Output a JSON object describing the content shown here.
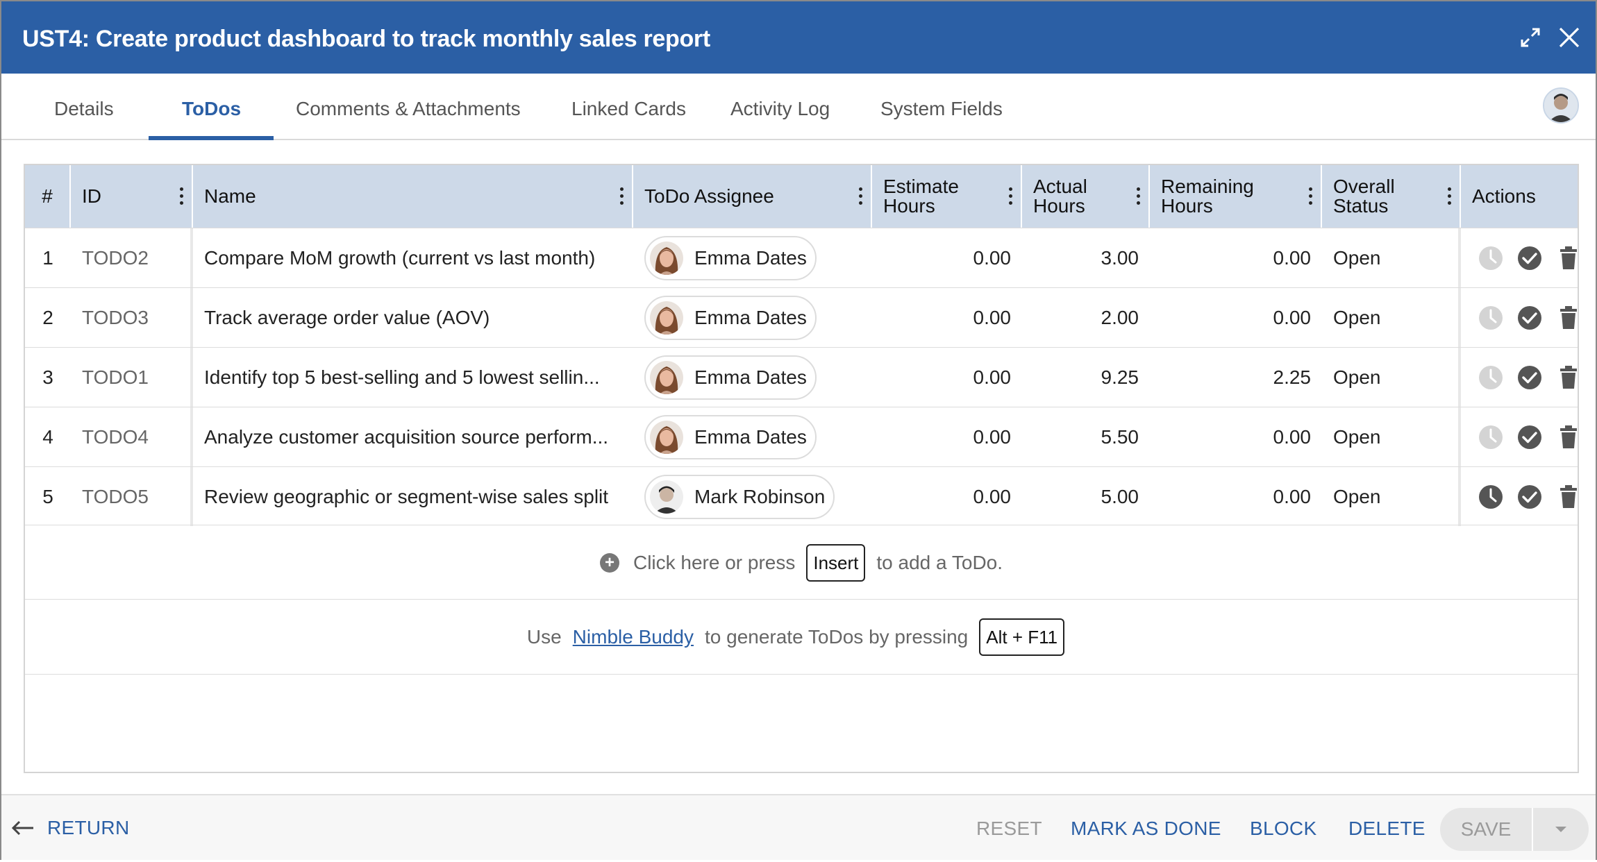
{
  "header": {
    "title": "UST4: Create product dashboard to track monthly sales report",
    "color": "#2b5fa5"
  },
  "tabs": [
    {
      "label": "Details"
    },
    {
      "label": "ToDos",
      "active": true
    },
    {
      "label": "Comments & Attachments"
    },
    {
      "label": "Linked Cards"
    },
    {
      "label": "Activity Log"
    },
    {
      "label": "System Fields"
    }
  ],
  "table": {
    "columns": {
      "num": "#",
      "id": "ID",
      "name": "Name",
      "assignee": "ToDo Assignee",
      "estimate": "Estimate Hours",
      "actual": "Actual Hours",
      "remaining": "Remaining Hours",
      "status": "Overall Status",
      "actions": "Actions"
    },
    "rows": [
      {
        "num": "1",
        "id": "TODO2",
        "name": "Compare MoM growth (current vs last month)",
        "assignee": "Emma Dates",
        "estimate": "0.00",
        "actual": "3.00",
        "remaining": "0.00",
        "status": "Open"
      },
      {
        "num": "2",
        "id": "TODO3",
        "name": "Track average order value (AOV)",
        "assignee": "Emma Dates",
        "estimate": "0.00",
        "actual": "2.00",
        "remaining": "0.00",
        "status": "Open"
      },
      {
        "num": "3",
        "id": "TODO1",
        "name": "Identify top 5 best-selling and 5 lowest sellin...",
        "assignee": "Emma Dates",
        "estimate": "0.00",
        "actual": "9.25",
        "remaining": "2.25",
        "status": "Open"
      },
      {
        "num": "4",
        "id": "TODO4",
        "name": "Analyze customer acquisition source perform...",
        "assignee": "Emma Dates",
        "estimate": "0.00",
        "actual": "5.50",
        "remaining": "0.00",
        "status": "Open"
      },
      {
        "num": "5",
        "id": "TODO5",
        "name": "Review geographic or segment-wise sales split",
        "assignee": "Mark Robinson",
        "estimate": "0.00",
        "actual": "5.00",
        "remaining": "0.00",
        "status": "Open"
      }
    ]
  },
  "add_todo": {
    "prefix": "Click here or press",
    "key": "Insert",
    "suffix": "to add a ToDo."
  },
  "buddy": {
    "prefix": "Use",
    "link": "Nimble Buddy",
    "middle": "to generate ToDos by pressing",
    "key": "Alt + F11"
  },
  "footer": {
    "return": "RETURN",
    "reset": "RESET",
    "mark_done": "MARK AS DONE",
    "block": "BLOCK",
    "delete": "DELETE",
    "save": "SAVE"
  }
}
